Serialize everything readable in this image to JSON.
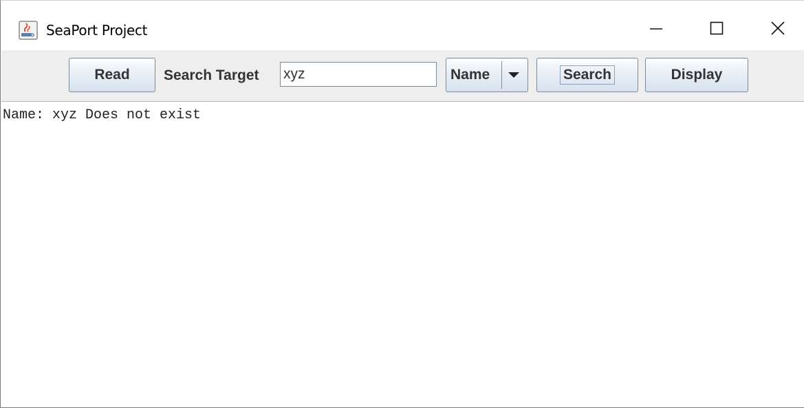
{
  "window": {
    "title": "SeaPort Project",
    "icons": {
      "app": "java-coffee-icon",
      "minimize": "minimize-icon",
      "maximize": "maximize-icon",
      "close": "close-icon"
    }
  },
  "toolbar": {
    "read_label": "Read",
    "search_target_label": "Search Target",
    "search_input_value": "xyz",
    "search_type_selected": "Name",
    "search_label": "Search",
    "display_label": "Display"
  },
  "output": {
    "text": "Name: xyz Does not exist"
  },
  "colors": {
    "toolbar_bg": "#eeeeee",
    "button_border": "#7a8a99",
    "text": "#333333"
  }
}
